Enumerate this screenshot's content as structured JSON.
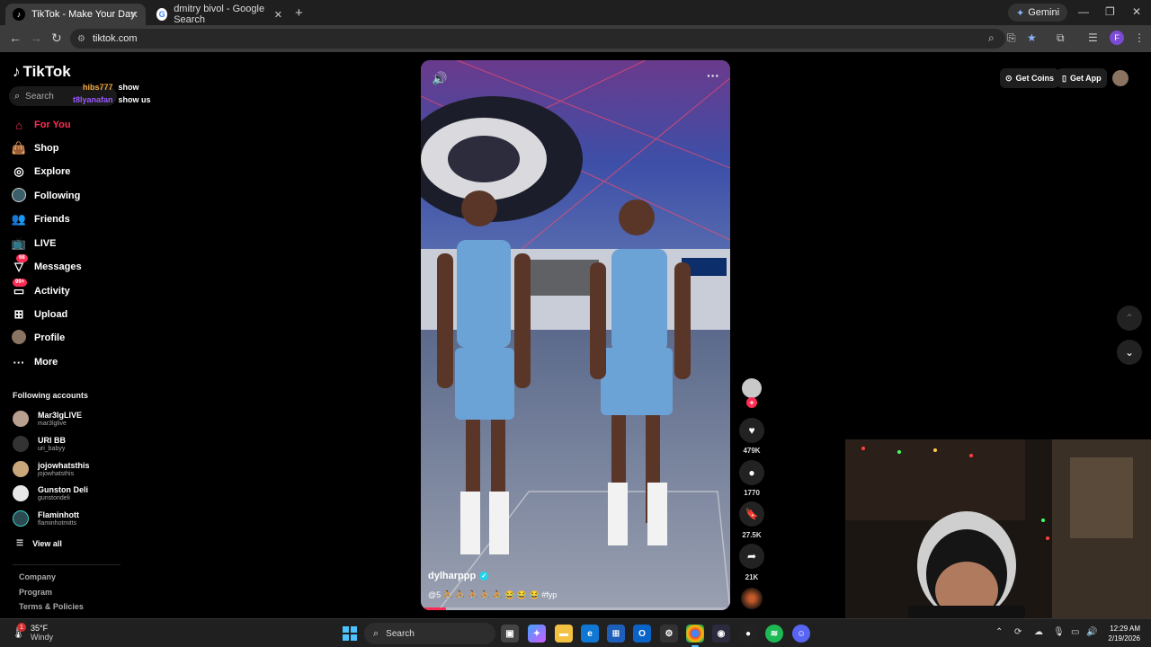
{
  "browser": {
    "tabs": [
      {
        "title": "TikTok - Make Your Day",
        "active": true
      },
      {
        "title": "dmitry bivol - Google Search",
        "active": false
      }
    ],
    "gemini_label": "Gemini",
    "url": "tiktok.com",
    "profile_initial": "F"
  },
  "tiktok": {
    "logo": "TikTok",
    "search_placeholder": "Search",
    "chat_overlay": [
      {
        "user": "hibs777",
        "message": "show"
      },
      {
        "user": "t8lyanafan",
        "message": "show us"
      }
    ],
    "nav": [
      {
        "label": "For You",
        "icon": "home-icon",
        "active": true
      },
      {
        "label": "Shop",
        "icon": "shopping-bag-icon"
      },
      {
        "label": "Explore",
        "icon": "compass-icon"
      },
      {
        "label": "Following",
        "icon": "following-avatar-icon"
      },
      {
        "label": "Friends",
        "icon": "friends-icon"
      },
      {
        "label": "LIVE",
        "icon": "live-tv-icon"
      },
      {
        "label": "Messages",
        "icon": "messages-icon",
        "badge": "68"
      },
      {
        "label": "Activity",
        "icon": "activity-icon",
        "badge": "99+"
      },
      {
        "label": "Upload",
        "icon": "upload-icon"
      },
      {
        "label": "Profile",
        "icon": "profile-avatar-icon"
      },
      {
        "label": "More",
        "icon": "more-icon"
      }
    ],
    "following_title": "Following accounts",
    "following": [
      {
        "name": "Mar3lgLIVE",
        "handle": "mar3lglive"
      },
      {
        "name": "URI BB",
        "handle": "uri_babyy"
      },
      {
        "name": "jojowhatsthis",
        "handle": "jojowhatsthis"
      },
      {
        "name": "Gunston Deli",
        "handle": "gunstondeli"
      },
      {
        "name": "Flaminhott",
        "handle": "flaminhotmitts"
      }
    ],
    "view_all": "View all",
    "footer_links": [
      "Company",
      "Program",
      "Terms & Policies"
    ],
    "top_buttons": {
      "coins": "Get Coins",
      "app": "Get App"
    },
    "video": {
      "username": "dylharppp",
      "caption": "@5 ⛹ ⛹ ⛹ ⛹ ⛹ 😂 😂 😂 #fyp",
      "progress": 0.08
    },
    "actions": {
      "likes": "479K",
      "comments": "1770",
      "saves": "27.5K",
      "shares": "21K"
    }
  },
  "taskbar": {
    "weather_temp": "35°F",
    "weather_cond": "Windy",
    "weather_badge": "1",
    "search_placeholder": "Search",
    "time": "12:29 AM",
    "date": "2/19/2026"
  }
}
